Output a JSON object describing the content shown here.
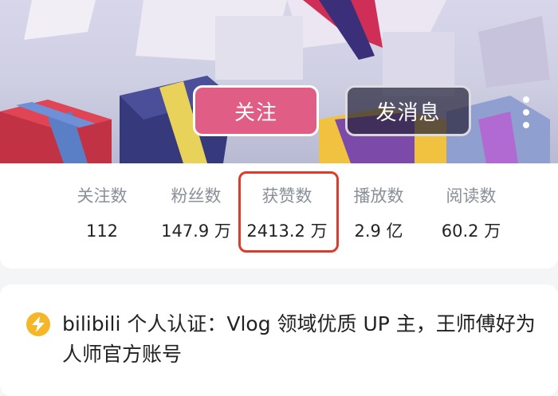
{
  "header": {
    "follow_label": "关注",
    "message_label": "发消息",
    "follow_color": "#e05d85",
    "more_icon": "more-vertical-icon"
  },
  "stats": [
    {
      "label": "关注数",
      "value": "112"
    },
    {
      "label": "粉丝数",
      "value": "147.9 万"
    },
    {
      "label": "获赞数",
      "value": "2413.2 万"
    },
    {
      "label": "播放数",
      "value": "2.9 亿"
    },
    {
      "label": "阅读数",
      "value": "60.2 万"
    }
  ],
  "highlight_color": "#e03a2a",
  "verification": {
    "icon": "lightning-icon",
    "icon_color": "#f5b728",
    "text": "bilibili 个人认证：Vlog 领域优质 UP 主，王师傅好为人师官方账号"
  }
}
